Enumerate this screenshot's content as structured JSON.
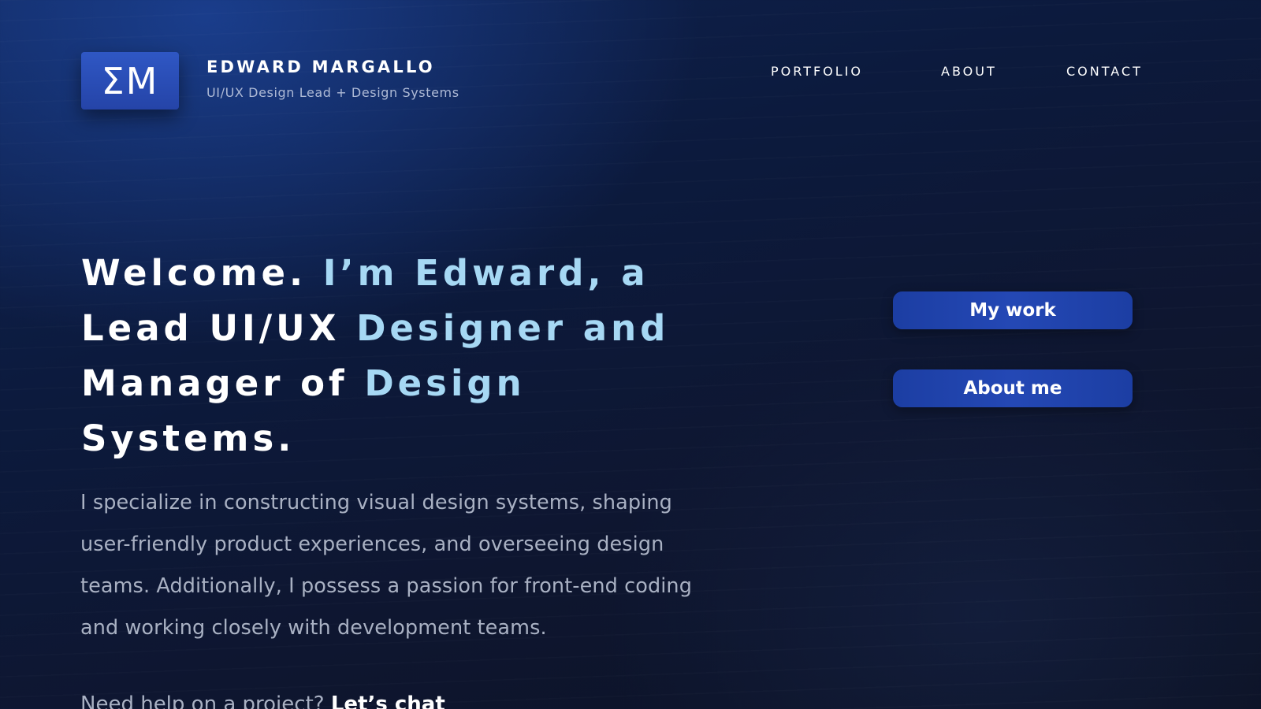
{
  "brand": {
    "logo_text": "ΣM",
    "name": "EDWARD MARGALLO",
    "tagline": "UI/UX Design Lead + Design Systems"
  },
  "nav": {
    "items": [
      {
        "label": "PORTFOLIO"
      },
      {
        "label": "ABOUT"
      },
      {
        "label": "CONTACT"
      }
    ]
  },
  "hero": {
    "headline_parts": [
      "Welcome. ",
      "I’m Edward, a",
      "Lead UI/UX ",
      "Designer and",
      "Manager of ",
      "Design",
      "Systems."
    ],
    "intro": "I specialize in constructing visual design systems, shaping user-friendly product experiences, and overseeing design teams. Additionally, I possess a passion for front-end coding and working closely with development teams.",
    "cta_question": "Need help on a project? ",
    "cta_link": "Let’s chat"
  },
  "buttons": {
    "my_work": "My work",
    "about_me": "About me"
  },
  "colors": {
    "accent": "#2448b5",
    "headline_highlight": "#a6d8f4",
    "background": "#0e1a3c",
    "body_text": "#a9b1c3"
  }
}
